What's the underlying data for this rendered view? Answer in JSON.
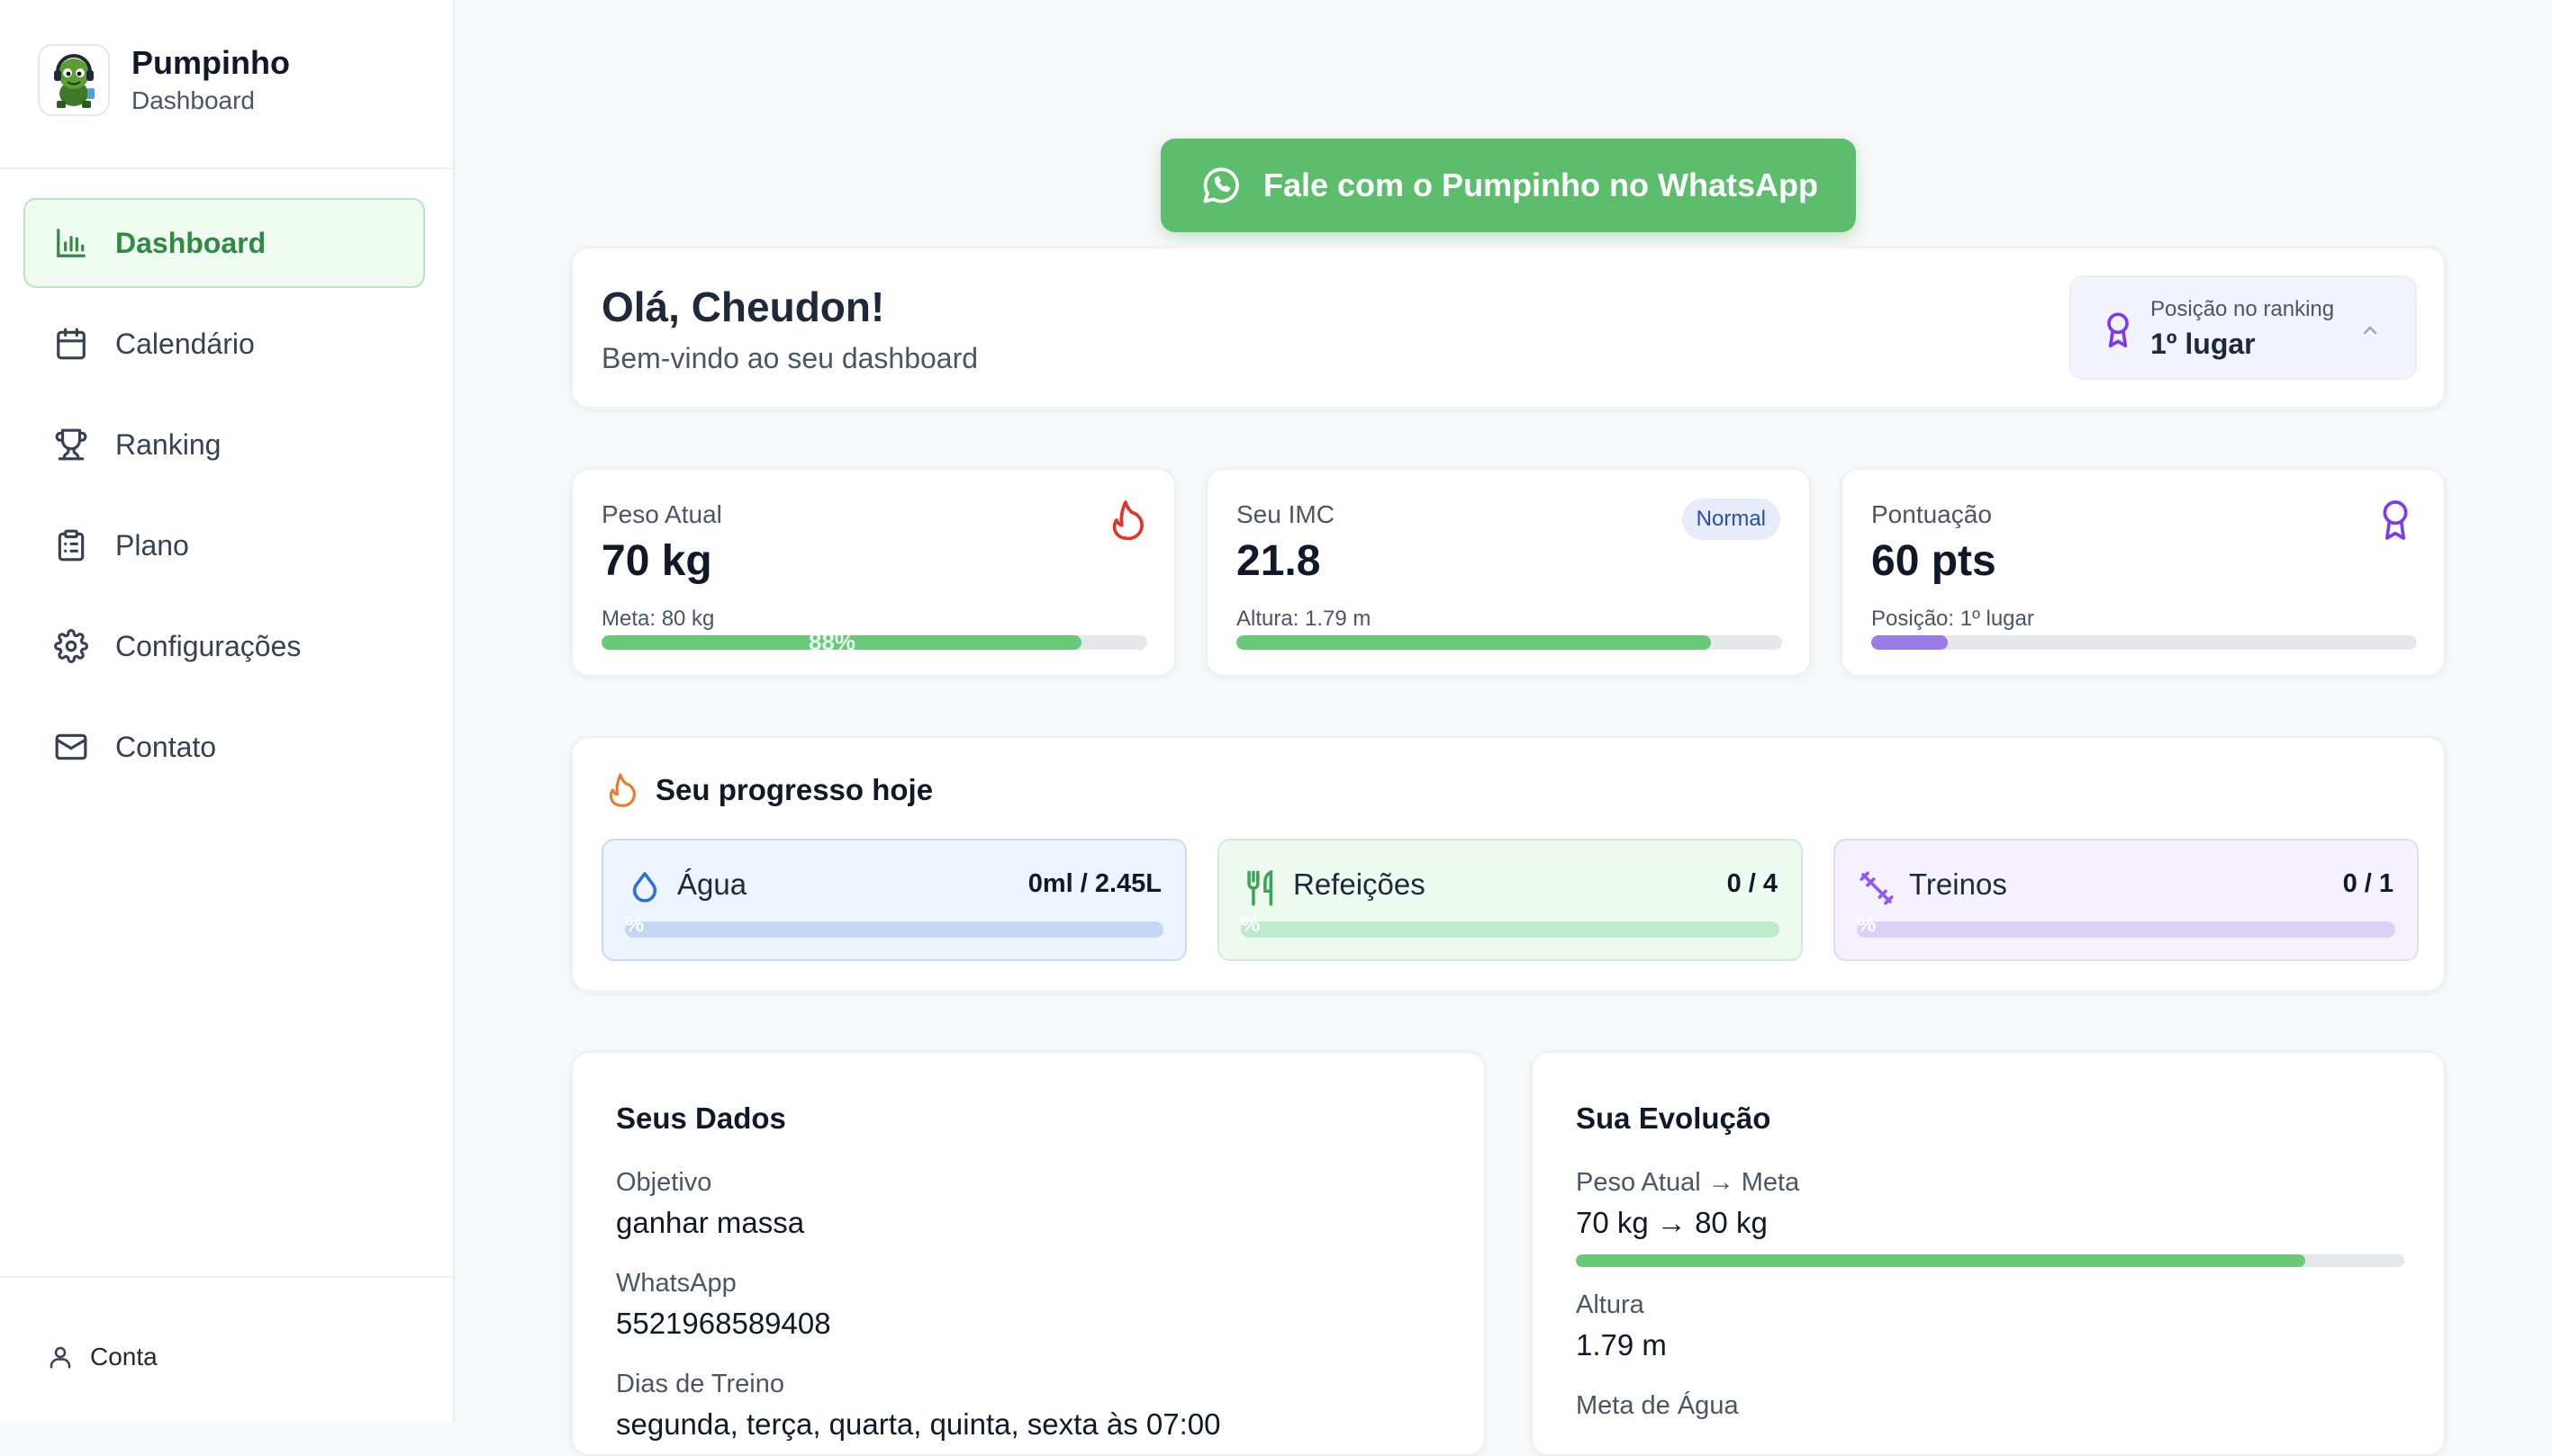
{
  "brand": {
    "title": "Pumpinho",
    "subtitle": "Dashboard",
    "logo_icon": "frog-mascot-icon"
  },
  "nav": {
    "items": [
      {
        "label": "Dashboard",
        "icon": "bar-chart-icon",
        "active": true
      },
      {
        "label": "Calendário",
        "icon": "calendar-icon"
      },
      {
        "label": "Ranking",
        "icon": "trophy-icon"
      },
      {
        "label": "Plano",
        "icon": "clipboard-icon"
      },
      {
        "label": "Configurações",
        "icon": "gear-icon"
      },
      {
        "label": "Contato",
        "icon": "mail-icon"
      }
    ]
  },
  "account": {
    "label": "Conta",
    "icon": "user-icon"
  },
  "whatsapp": {
    "label": "Fale com o Pumpinho no WhatsApp",
    "icon": "whatsapp-icon"
  },
  "welcome": {
    "title": "Olá, Cheudon!",
    "subtitle": "Bem-vindo ao seu dashboard",
    "ranking_label": "Posição no ranking",
    "ranking_value": "1º lugar"
  },
  "stats": {
    "weight": {
      "label": "Peso Atual",
      "value": "70 kg",
      "sub": "Meta: 80 kg",
      "progress_percent": 88,
      "progress_text": "88%",
      "icon": "flame-icon"
    },
    "bmi": {
      "label": "Seu IMC",
      "value": "21.8",
      "badge": "Normal",
      "sub": "Altura: 1.79 m",
      "progress_percent": 87
    },
    "score": {
      "label": "Pontuação",
      "value": "60 pts",
      "sub": "Posição: 1º lugar",
      "progress_percent": 14,
      "icon": "medal-icon"
    }
  },
  "progress_today": {
    "title": "Seu progresso hoje",
    "water": {
      "label": "Água",
      "count": "0ml / 2.45L",
      "pct_text": "%",
      "icon": "droplet-icon"
    },
    "meals": {
      "label": "Refeições",
      "count": "0 / 4",
      "pct_text": "%",
      "icon": "utensils-icon"
    },
    "workouts": {
      "label": "Treinos",
      "count": "0 / 1",
      "pct_text": "%",
      "icon": "dumbbell-icon"
    }
  },
  "seus_dados": {
    "title": "Seus Dados",
    "objetivo_label": "Objetivo",
    "objetivo_value": "ganhar massa",
    "whatsapp_label": "WhatsApp",
    "whatsapp_value": "5521968589408",
    "dias_label": "Dias de Treino",
    "dias_value": "segunda, terça, quarta, quinta, sexta às 07:00"
  },
  "evolucao": {
    "title": "Sua Evolução",
    "peso_label": "Peso Atual → Meta",
    "peso_value": "70 kg → 80 kg",
    "progress_percent": 88,
    "altura_label": "Altura",
    "altura_value": "1.79 m",
    "agua_label": "Meta de Água"
  },
  "colors": {
    "accent_green": "#5cbd6c",
    "bar_green": "#69c978",
    "purple": "#9b7be8",
    "active_nav_text": "#2f8a44"
  }
}
